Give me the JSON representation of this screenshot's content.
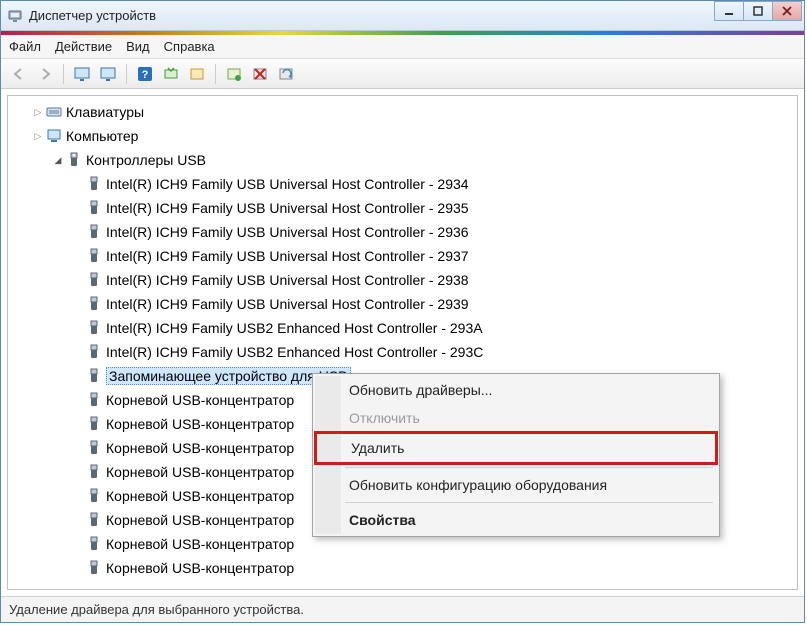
{
  "window": {
    "title": "Диспетчер устройств"
  },
  "menubar": {
    "file": "Файл",
    "action": "Действие",
    "view": "Вид",
    "help": "Справка"
  },
  "tree": {
    "keyboards": "Клавиатуры",
    "computer": "Компьютер",
    "usb_controllers": "Контроллеры USB",
    "usb_children": [
      "Intel(R) ICH9 Family USB Universal Host Controller - 2934",
      "Intel(R) ICH9 Family USB Universal Host Controller - 2935",
      "Intel(R) ICH9 Family USB Universal Host Controller - 2936",
      "Intel(R) ICH9 Family USB Universal Host Controller - 2937",
      "Intel(R) ICH9 Family USB Universal Host Controller - 2938",
      "Intel(R) ICH9 Family USB Universal Host Controller - 2939",
      "Intel(R) ICH9 Family USB2 Enhanced Host Controller - 293A",
      "Intel(R) ICH9 Family USB2 Enhanced Host Controller - 293C"
    ],
    "usb_storage": "Запоминающее устройство для USB",
    "usb_hubs": [
      "Корневой USB-концентратор",
      "Корневой USB-концентратор",
      "Корневой USB-концентратор",
      "Корневой USB-концентратор",
      "Корневой USB-концентратор",
      "Корневой USB-концентратор",
      "Корневой USB-концентратор",
      "Корневой USB-концентратор"
    ]
  },
  "context_menu": {
    "update_drivers": "Обновить драйверы...",
    "disable": "Отключить",
    "delete": "Удалить",
    "scan_hardware": "Обновить конфигурацию оборудования",
    "properties": "Свойства"
  },
  "statusbar": {
    "text": "Удаление драйвера для выбранного устройства."
  }
}
